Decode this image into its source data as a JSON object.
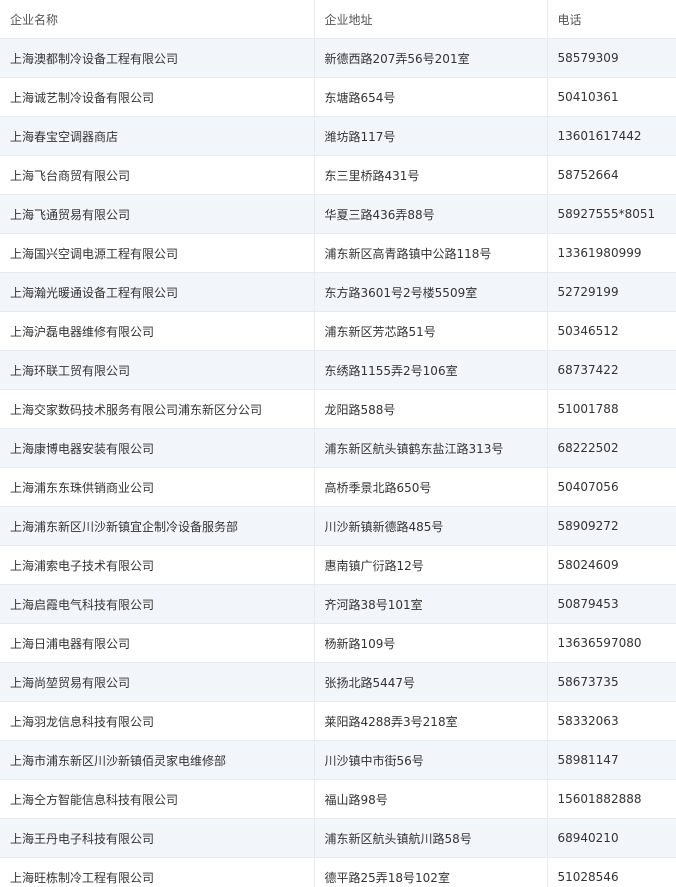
{
  "table": {
    "headers": [
      "企业名称",
      "企业地址",
      "电话"
    ],
    "rows": [
      [
        "上海澳都制冷设备工程有限公司",
        "新德西路207弄56号201室",
        "58579309"
      ],
      [
        "上海诚艺制冷设备有限公司",
        "东塘路654号",
        "50410361"
      ],
      [
        "上海春宝空调器商店",
        "潍坊路117号",
        "13601617442"
      ],
      [
        "上海飞台商贸有限公司",
        "东三里桥路431号",
        "58752664"
      ],
      [
        "上海飞通贸易有限公司",
        "华夏三路436弄88号",
        "58927555*8051"
      ],
      [
        "上海国兴空调电源工程有限公司",
        "浦东新区高青路镇中公路118号",
        "13361980999"
      ],
      [
        "上海瀚光暖通设备工程有限公司",
        "东方路3601号2号楼5509室",
        "52729199"
      ],
      [
        "上海沪磊电器维修有限公司",
        "浦东新区芳芯路51号",
        "50346512"
      ],
      [
        "上海环联工贸有限公司",
        "东绣路1155弄2号106室",
        "68737422"
      ],
      [
        "上海交家数码技术服务有限公司浦东新区分公司",
        "龙阳路588号",
        "51001788"
      ],
      [
        "上海康博电器安装有限公司",
        "浦东新区航头镇鹤东盐江路313号",
        "68222502"
      ],
      [
        "上海浦东东珠供销商业公司",
        "高桥季景北路650号",
        "50407056"
      ],
      [
        "上海浦东新区川沙新镇宜企制冷设备服务部",
        "川沙新镇新德路485号",
        "58909272"
      ],
      [
        "上海浦索电子技术有限公司",
        "惠南镇广衍路12号",
        "58024609"
      ],
      [
        "上海启霞电气科技有限公司",
        "齐河路38号101室",
        "50879453"
      ],
      [
        "上海日浦电器有限公司",
        "杨新路109号",
        "13636597080"
      ],
      [
        "上海尚堃贸易有限公司",
        "张扬北路5447号",
        "58673735"
      ],
      [
        "上海羽龙信息科技有限公司",
        "莱阳路4288弄3号218室",
        "58332063"
      ],
      [
        "上海市浦东新区川沙新镇佰灵家电维修部",
        "川沙镇中市街56号",
        "58981147"
      ],
      [
        "上海仝方智能信息科技有限公司",
        "福山路98号",
        "15601882888"
      ],
      [
        "上海王丹电子科技有限公司",
        "浦东新区航头镇航川路58号",
        "68940210"
      ],
      [
        "上海旺栋制冷工程有限公司",
        "德平路25弄18号102室",
        "51028546"
      ]
    ]
  }
}
